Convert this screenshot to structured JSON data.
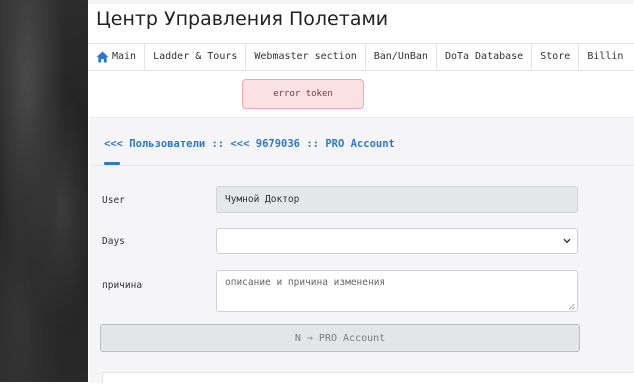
{
  "page": {
    "title": "Центр Управления Полетами"
  },
  "nav": {
    "items": [
      {
        "label": "Main",
        "icon": "home-icon"
      },
      {
        "label": "Ladder & Tours"
      },
      {
        "label": "Webmaster section"
      },
      {
        "label": "Ban/UnBan"
      },
      {
        "label": "DoTa Database"
      },
      {
        "label": "Store"
      },
      {
        "label": "Billin"
      }
    ]
  },
  "alert": {
    "text": "error token"
  },
  "breadcrumb": {
    "users_link": "<<< Пользователи",
    "sep1": "::",
    "id_link": "<<< 9679036",
    "sep2": "::",
    "current": "PRO Account"
  },
  "form": {
    "user_label": "User",
    "user_value": "Чумной Доктор",
    "days_label": "Days",
    "days_value": "",
    "reason_label": "причина",
    "reason_placeholder": "описание и причина изменения",
    "submit_label": "N ⇒ PRO Account"
  },
  "colors": {
    "accent": "#2f78c4",
    "alert_bg": "#fbe1e3",
    "alert_border": "#f0a8ae"
  }
}
